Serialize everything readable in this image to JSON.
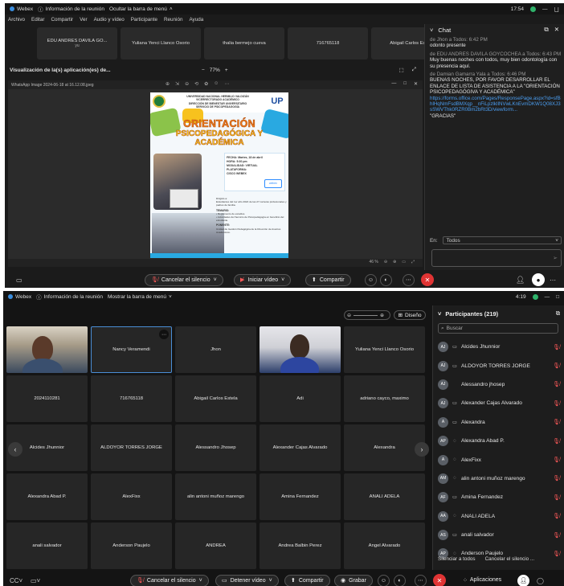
{
  "top": {
    "titlebar": {
      "app": "Webex",
      "meeting_info": "Información de la reunión",
      "hide_menu": "Ocultar la barra de menú",
      "time": "17:54",
      "min": "—",
      "close": "ㄩ"
    },
    "menu": [
      "Archivo",
      "Editar",
      "Compartir",
      "Ver",
      "Audio y vídeo",
      "Participante",
      "Reunión",
      "Ayuda"
    ],
    "thumbnails": [
      "EDU ANDRES DAVILA GO...",
      "Yuliana Yenci Llanco Osorio",
      "thalia bermejo cueva",
      "716765118",
      "Abigail Carlos Estela"
    ],
    "thumbnail_sub": "yu",
    "share": {
      "title": "Visualización de la(s) aplicación(es) de...",
      "minus": "−",
      "zoom": "77%",
      "plus": "+",
      "icons": [
        "⬚",
        "⤢"
      ]
    },
    "app_window": {
      "title": "WhatsApp Image 2024-06-18 at 16.12.08.jpeg",
      "tools": [
        "⊕",
        "⇲",
        "⊖",
        "⟲",
        "✿",
        "☺",
        "⋯"
      ],
      "ctrls": [
        "—",
        "□",
        "✕"
      ],
      "zoom": "46 %"
    },
    "poster": {
      "header": "UNIVERSIDAD NACIONAL HERMILIO VALDIZÁN\nVICERRECTORADO ACADÉMICO\nDIRECCIÓN DE BIENESTAR UNIVERSITARIO\nSERVICIO DE PSICOPEDAGOGÍA",
      "logo_right": "UP",
      "title1": "ORIENTACIÓN",
      "title2": "PSICOPEDAGÓGICA Y",
      "title3": "ACADÉMICA",
      "info": "FECHA: Martes, 18 de abril\nHORA: 5:30 pm\nMODALIDAD: VIRTUAL\nPLATAFORMA:\nCISCO WEBEX",
      "zoom_logo": "webex",
      "body": "Dirigido a:\nEstudiantes del 1er año 2024 de las 27 carreras profesionales y padres de familia.",
      "temario_title": "TEMARIO:",
      "temario": "• Reglamento de estudios.\n• Actividades del Servicio de Psicopedagogía en beneficio del estudiante.",
      "ponente_title": "PONENTE:",
      "ponente": "Unidad de Gestión Pedagógica de la Dirección de Asuntos Académicos."
    },
    "chat": {
      "title": "Chat",
      "messages": [
        {
          "meta": "de Jhon a Todos:   6:42 PM",
          "text": "odonto presente"
        },
        {
          "meta": "de EDU ANDRES DAVILA GOYCOCHEA a Todos:   6:43 PM",
          "text": "Muy buenas noches con todos, muy bien odontología con su presencia aquí."
        },
        {
          "meta": "de Damian Gamarra Yala a Todos:   6:46 PM",
          "text": "BUENAS NOCHES, POR FAVOR DESARROLLAR EL ENLACE DE LISTA DE ASISTENCIA A LA \"ORIENTACIÓN PSICOPEDAGÓGIVA Y ACADÉMICA\"",
          "link": "https://forms.office.com/Pages/ResponsePage.aspx?id=sfBhlHqNmFsdBMXqp__nFiLpzlkIlNVwLKnEvmDKW1Q08XJ3sSWVThk0RZR0Bm2bRt3D/viewform...",
          "after": "\"GRACIAS\""
        }
      ],
      "to_label": "En:",
      "to_value": "Todos"
    },
    "controls": {
      "mute": "Cancelar el silencio",
      "video": "Iniciar vídeo",
      "share": "Compartir"
    }
  },
  "bottom": {
    "titlebar": {
      "app": "Webex",
      "meeting_info": "Información de la reunión",
      "show_menu": "Mostrar la barra de menú",
      "time": "4:19"
    },
    "layout_button": "Diseño",
    "tiles": [
      "",
      "Nancy Veramendi",
      "Jhon",
      "",
      "Yuliana Yenci Llanco Osorio",
      "2024110281",
      "716765118",
      "Abigail Carlos Estela",
      "Adi",
      "adriano cayco, maximo",
      "Alcides Jhunnior",
      "ALDOYOR TORRES JORGE",
      "Alessandro Jhosep",
      "Alexander Cajas Alvarado",
      "Alexandra",
      "Alexandra Abad P.",
      "AlexFixx",
      "alin antoni muñoz marengo",
      "Amina Fernandez",
      "ANALI ADELA",
      "anali salvador",
      "Anderson Paujelo",
      "ANDREA",
      "Andrea Balbin Perez",
      "Angel Alvarado"
    ],
    "participants": {
      "title": "Participantes (219)",
      "search_placeholder": "Buscar",
      "list": [
        {
          "initials": "AJ",
          "name": "Alcides Jhunnior",
          "device": "▭"
        },
        {
          "initials": "AJ",
          "name": "ALDOYOR TORRES JORGE",
          "device": "▭"
        },
        {
          "initials": "AJ",
          "name": "Alessandro jhosep",
          "device": ""
        },
        {
          "initials": "AJ",
          "name": "Alexander Cajas Alvarado",
          "device": "▭"
        },
        {
          "initials": "A",
          "name": "Alexandra",
          "device": "▭"
        },
        {
          "initials": "AP",
          "name": "Alexandra Abad P.",
          "device": "◌"
        },
        {
          "initials": "A",
          "name": "AlexFixx",
          "device": "◌"
        },
        {
          "initials": "AM",
          "name": "alin antoni muñoz marengo",
          "device": "◌"
        },
        {
          "initials": "AF",
          "name": "Amina Fernandez",
          "device": "▭"
        },
        {
          "initials": "AA",
          "name": "ANALI ADELA",
          "device": "◌"
        },
        {
          "initials": "AS",
          "name": "anali salvador",
          "device": "▭"
        },
        {
          "initials": "AP",
          "name": "Anderson Paujelo",
          "device": "◌"
        }
      ],
      "silence_all": "Silenciar a todos",
      "unmute_all": "Cancelar el silencio ..."
    },
    "controls": {
      "mute": "Cancelar el silencio",
      "stop_video": "Detener vídeo",
      "share": "Compartir",
      "record": "Grabar",
      "apps": "Aplicaciones"
    }
  }
}
